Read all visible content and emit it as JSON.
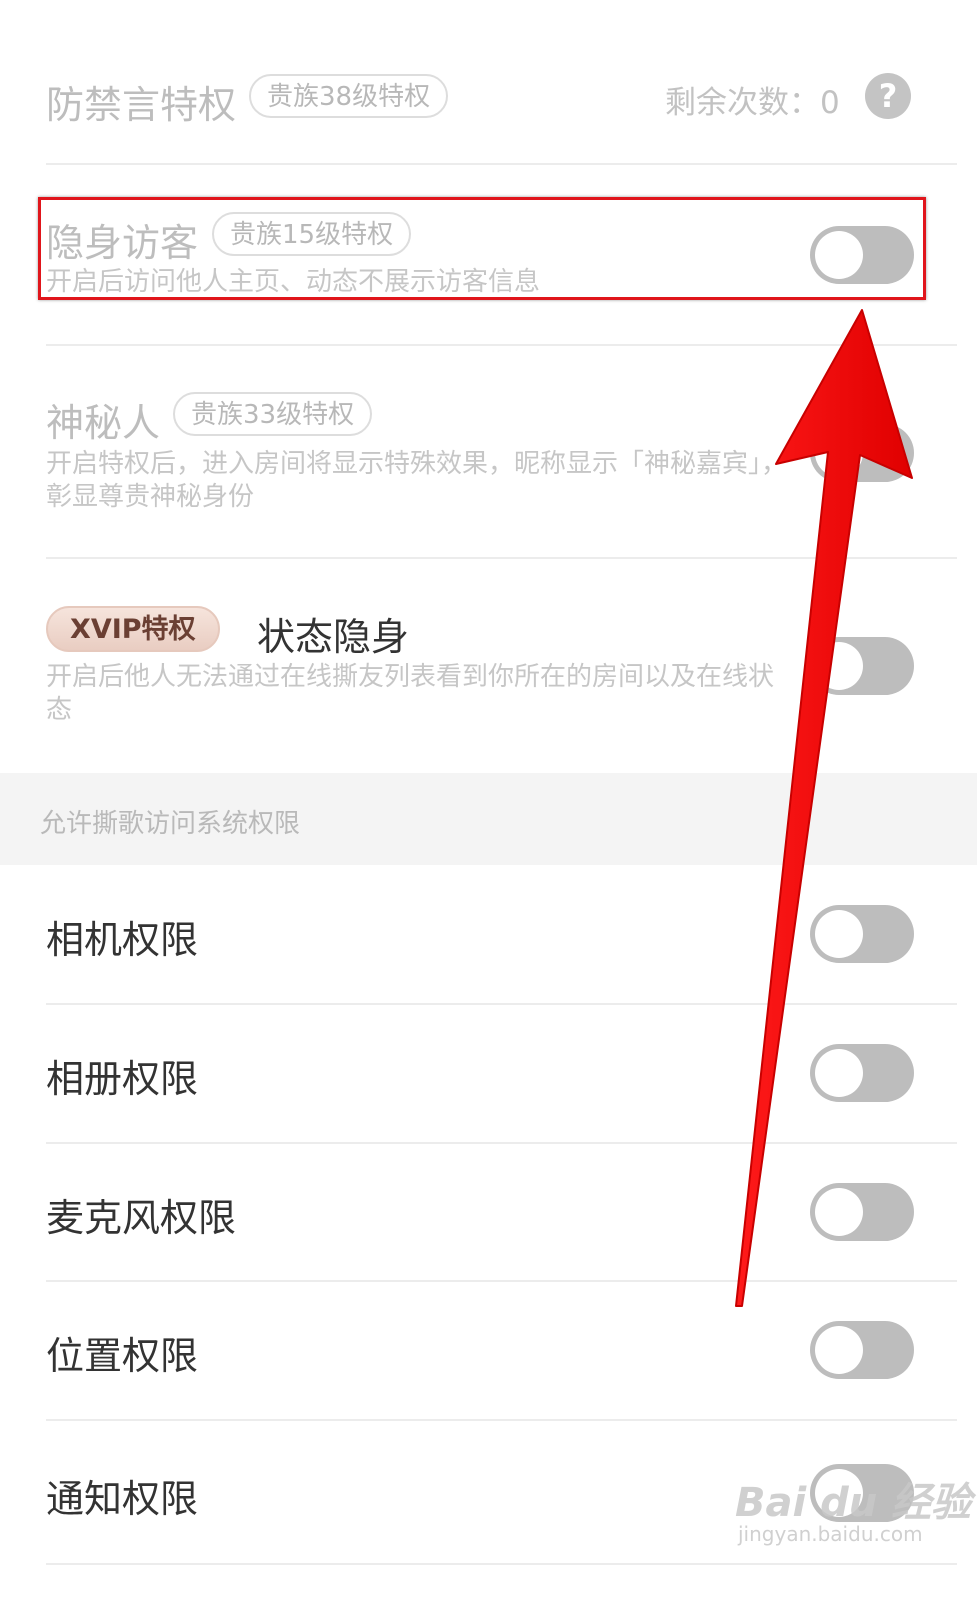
{
  "anti_ban": {
    "title": "防禁言特权",
    "tag": "贵族38级特权",
    "remaining": "剩余次数：0",
    "help_icon": "help-circle-icon"
  },
  "invisible_visitor": {
    "title": "隐身访客",
    "tag": "贵族15级特权",
    "desc": "开启后访问他人主页、动态不展示访客信息",
    "enabled": false
  },
  "mystery_person": {
    "title": "神秘人",
    "tag": "贵族33级特权",
    "desc": "开启特权后，进入房间将显示特殊效果，昵称显示「神秘嘉宾」，彰显尊贵神秘身份",
    "enabled": false
  },
  "status_invisible": {
    "badge": "XVIP特权",
    "title": "状态隐身",
    "desc": "开启后他人无法通过在线撕友列表看到你所在的房间以及在线状态",
    "enabled": false
  },
  "system_permissions": {
    "header": "允许撕歌访问系统权限",
    "items": [
      {
        "label": "相机权限",
        "enabled": false
      },
      {
        "label": "相册权限",
        "enabled": false
      },
      {
        "label": "麦克风权限",
        "enabled": false
      },
      {
        "label": "位置权限",
        "enabled": false
      },
      {
        "label": "通知权限",
        "enabled": false
      }
    ]
  },
  "watermark": {
    "brand": "Bai du 经验",
    "url": "jingyan.baidu.com"
  },
  "colors": {
    "annotation_red": "#e0151b",
    "toggle_off": "#bdbdbd"
  }
}
